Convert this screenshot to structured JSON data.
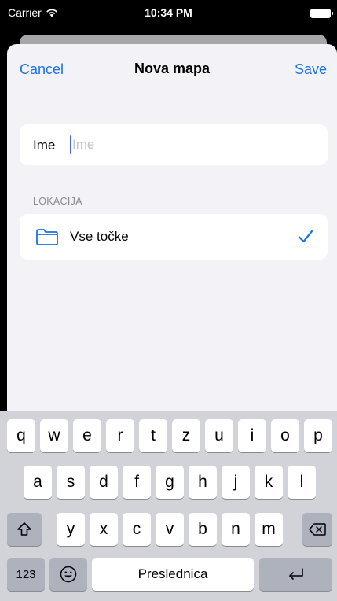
{
  "status_bar": {
    "carrier": "Carrier",
    "time": "10:34 PM"
  },
  "nav": {
    "cancel_label": "Cancel",
    "title": "Nova mapa",
    "save_label": "Save"
  },
  "name_field": {
    "label": "Ime",
    "placeholder": "Ime",
    "value": ""
  },
  "location_section": {
    "header": "LOKACIJA",
    "item": {
      "label": "Vse točke",
      "icon": "folder-icon",
      "selected": true,
      "check_icon": "checkmark-icon"
    }
  },
  "colors": {
    "accent": "#1a73e8",
    "background": "#f2f2f7",
    "card": "#ffffff",
    "caret": "#4a64f5"
  },
  "keyboard": {
    "row1": [
      "q",
      "w",
      "e",
      "r",
      "t",
      "z",
      "u",
      "i",
      "o",
      "p"
    ],
    "row2": [
      "a",
      "s",
      "d",
      "f",
      "g",
      "h",
      "j",
      "k",
      "l"
    ],
    "row3": [
      "y",
      "x",
      "c",
      "v",
      "b",
      "n",
      "m"
    ],
    "shift_icon": "shift-icon",
    "backspace_icon": "backspace-icon",
    "numbers_label": "123",
    "emoji_icon": "emoji-icon",
    "space_label": "Preslednica",
    "return_icon": "return-icon"
  }
}
